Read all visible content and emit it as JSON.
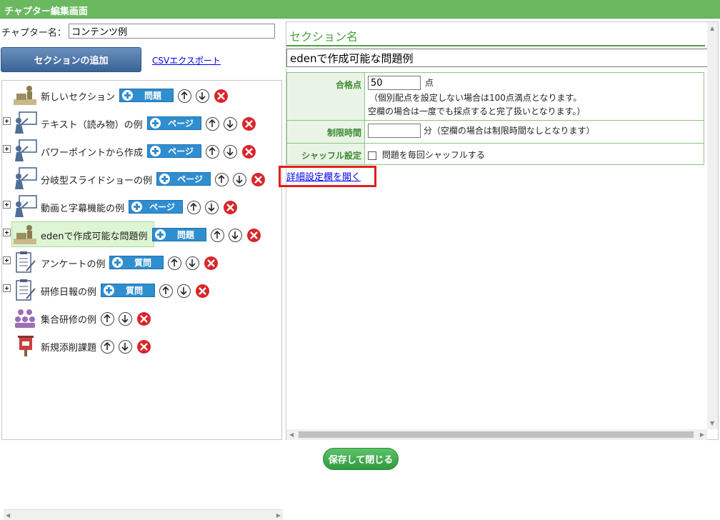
{
  "window": {
    "title": "チャプター編集画面"
  },
  "chapter": {
    "name_label": "チャプター名：",
    "name_value": "コンテンツ例"
  },
  "toolbar": {
    "add_section_label": "セクションの追加",
    "csv_export_label": "CSVエクスポート"
  },
  "tree": {
    "items": [
      {
        "label": "新しいセクション",
        "tag": "問題",
        "icon": "teacher-desk-icon",
        "expandable": false,
        "selected": false
      },
      {
        "label": "テキスト（読み物）の例",
        "tag": "ページ",
        "icon": "presenter-board-icon",
        "expandable": true,
        "selected": false
      },
      {
        "label": "パワーポイントから作成",
        "tag": "ページ",
        "icon": "presenter-board-icon",
        "expandable": true,
        "selected": false
      },
      {
        "label": "分岐型スライドショーの例",
        "tag": "ページ",
        "icon": "presenter-board-icon",
        "expandable": false,
        "selected": false
      },
      {
        "label": "動画と字幕機能の例",
        "tag": "ページ",
        "icon": "presenter-board-icon",
        "expandable": true,
        "selected": false
      },
      {
        "label": "edenで作成可能な問題例",
        "tag": "問題",
        "icon": "teacher-desk-icon",
        "expandable": true,
        "selected": true
      },
      {
        "label": "アンケートの例",
        "tag": "質問",
        "icon": "clipboard-icon",
        "expandable": true,
        "selected": false
      },
      {
        "label": "研修日報の例",
        "tag": "質問",
        "icon": "clipboard-icon",
        "expandable": true,
        "selected": false
      },
      {
        "label": "集合研修の例",
        "tag": "",
        "icon": "group-training-icon",
        "expandable": false,
        "selected": false
      },
      {
        "label": "新規添削課題",
        "tag": "",
        "icon": "postbox-icon",
        "expandable": false,
        "selected": false
      }
    ]
  },
  "section": {
    "heading": "セクション名",
    "name_value": "edenで作成可能な問題例",
    "passing_label": "合格点",
    "passing_value": "50",
    "passing_unit": "点",
    "passing_note1": "（個別配点を設定しない場合は100点満点となります。",
    "passing_note2": "空欄の場合は一度でも採点すると完了扱いとなります。）",
    "time_label": "制限時間",
    "time_value": "",
    "time_unit": "分（空欄の場合は制限時間なしとなります）",
    "shuffle_label": "シャッフル設定",
    "shuffle_text": "問題を毎回シャッフルする",
    "shuffle_checked": false,
    "detail_link": "詳細設定欄を開く"
  },
  "footer": {
    "save_label": "保存して閉じる"
  },
  "colors": {
    "accent_green": "#6ab95f",
    "tag_blue": "#2f8ed0",
    "delete_red": "#d9262b",
    "highlight_red": "#e21d1d"
  }
}
